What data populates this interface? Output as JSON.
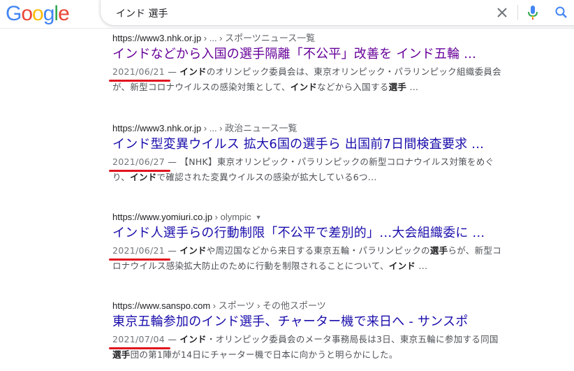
{
  "header": {
    "logo_letters": [
      {
        "ch": "G",
        "color": "#4285F4"
      },
      {
        "ch": "o",
        "color": "#EA4335"
      },
      {
        "ch": "o",
        "color": "#FBBC05"
      },
      {
        "ch": "g",
        "color": "#4285F4"
      },
      {
        "ch": "l",
        "color": "#34A853"
      },
      {
        "ch": "e",
        "color": "#EA4335"
      }
    ],
    "query": "インド 選手",
    "icons": [
      "close-icon",
      "microphone-icon",
      "search-icon"
    ]
  },
  "accent_colors": {
    "title_link": "#1a0dab",
    "title_visited": "#660099",
    "date_underline": "#e0151f"
  },
  "results": [
    {
      "url": "https://www3.nhk.or.jp",
      "breadcrumb": " › ... › スポーツニュース一覧",
      "title": "インドなどから入国の選手隔離「不公平」改善を インド五輪 ...",
      "visited": true,
      "date": "2021/06/21",
      "snippet_line1": [
        {
          "t": " — ",
          "b": false
        },
        {
          "t": "インド",
          "b": true
        },
        {
          "t": "のオリンピック委員会は、東京オリンピック・パラリンピック組織委員会",
          "b": false
        }
      ],
      "snippet_line2": [
        {
          "t": "が、新型コロナウイルスの感染対策として、",
          "b": false
        },
        {
          "t": "インド",
          "b": true
        },
        {
          "t": "などから入国する",
          "b": false
        },
        {
          "t": "選手",
          "b": true
        },
        {
          "t": " ...",
          "b": false
        }
      ]
    },
    {
      "url": "https://www3.nhk.or.jp",
      "breadcrumb": " › ... › 政治ニュース一覧",
      "title": "インド型変異ウイルス 拡大6国の選手ら 出国前7日間検査要求 ...",
      "visited": false,
      "date": "2021/06/27",
      "snippet_line1": [
        {
          "t": " — 【NHK】東京オリンピック・パラリンピックの新型コロナウイルス対策をめぐ",
          "b": false
        }
      ],
      "snippet_line2": [
        {
          "t": "り、",
          "b": false
        },
        {
          "t": "インド",
          "b": true
        },
        {
          "t": "で確認された変異ウイルスの感染が拡大している6つ...",
          "b": false
        }
      ]
    },
    {
      "url": "https://www.yomiuri.co.jp",
      "breadcrumb": " › olympic",
      "show_dropdown": true,
      "title": "インド人選手らの行動制限「不公平で差別的」…大会組織委に ...",
      "visited": false,
      "date": "2021/06/21",
      "snippet_line1": [
        {
          "t": " — ",
          "b": false
        },
        {
          "t": "インド",
          "b": true
        },
        {
          "t": "や周辺国などから来日する東京五輪・パラリンピックの",
          "b": false
        },
        {
          "t": "選手",
          "b": true
        },
        {
          "t": "らが、新型コ",
          "b": false
        }
      ],
      "snippet_line2": [
        {
          "t": "ロナウイルス感染拡大防止のために行動を制限されることについて、",
          "b": false
        },
        {
          "t": "インド",
          "b": true
        },
        {
          "t": " ...",
          "b": false
        }
      ]
    },
    {
      "url": "https://www.sanspo.com",
      "breadcrumb": " › スポーツ › その他スポーツ",
      "title": "東京五輪参加のインド選手、チャーター機で来日へ - サンスポ",
      "visited": false,
      "date": "2021/07/04",
      "snippet_line1": [
        {
          "t": " — ",
          "b": false
        },
        {
          "t": "インド",
          "b": true
        },
        {
          "t": "・オリンピック委員会のメータ事務局長は3日、東京五輪に参加する同国",
          "b": false
        }
      ],
      "snippet_line2": [
        {
          "t": "選手",
          "b": true
        },
        {
          "t": "団の第1陣が14日にチャーター機で日本に向かうと明らかにした。",
          "b": false
        }
      ]
    }
  ]
}
